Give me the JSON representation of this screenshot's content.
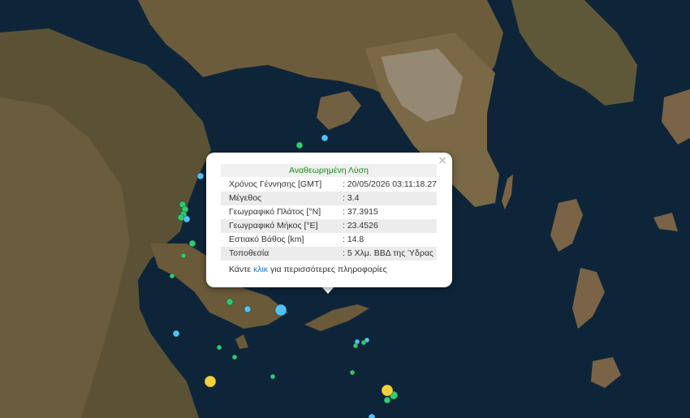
{
  "map": {
    "basemap": "satellite",
    "colors": {
      "sea": "#0d2438",
      "land": "#6b5a3c",
      "vegetation": "#4a4f2e",
      "urban": "#8e8370"
    },
    "events": [
      {
        "id": "e1",
        "color": "#2ecc71"
      },
      {
        "id": "e2",
        "color": "#2ecc71"
      },
      {
        "id": "e3",
        "color": "#2ecc71"
      },
      {
        "id": "e4",
        "color": "#2ecc71"
      },
      {
        "id": "e5",
        "color": "#2ecc71"
      },
      {
        "id": "e6",
        "color": "#2ecc71"
      },
      {
        "id": "e7",
        "color": "#2ecc71"
      },
      {
        "id": "e8",
        "color": "#2ecc71"
      },
      {
        "id": "e9",
        "color": "#2ecc71"
      },
      {
        "id": "e10",
        "color": "#2ecc71"
      },
      {
        "id": "e11",
        "color": "#2ecc71"
      },
      {
        "id": "e12",
        "color": "#2ecc71"
      },
      {
        "id": "e13",
        "color": "#2ecc71"
      },
      {
        "id": "e14",
        "color": "#2ecc71"
      },
      {
        "id": "e15",
        "color": "#2ecc71"
      },
      {
        "id": "e16",
        "color": "#2ecc71"
      },
      {
        "id": "e17",
        "color": "#2ecc71"
      },
      {
        "id": "e18",
        "color": "#4fc3f7"
      },
      {
        "id": "e19",
        "color": "#4fc3f7"
      },
      {
        "id": "e20",
        "color": "#4fc3f7"
      },
      {
        "id": "e21",
        "color": "#4fc3f7"
      },
      {
        "id": "e22",
        "color": "#4fc3f7"
      },
      {
        "id": "e23",
        "color": "#4fc3f7"
      },
      {
        "id": "e24",
        "color": "#4fc3f7"
      },
      {
        "id": "e25",
        "color": "#4fc3f7"
      },
      {
        "id": "e26",
        "color": "#4fc3f7"
      },
      {
        "id": "e27",
        "color": "#f1d23a"
      },
      {
        "id": "e28",
        "color": "#f1d23a"
      }
    ]
  },
  "popup": {
    "close_icon": "×",
    "title": "Αναθεωρημένη Λύση",
    "title_color": "#1e8a1e",
    "rows": [
      {
        "label": "Χρόνος Γέννησης [GMT]",
        "value": ": 20/05/2026 03:11:18.27"
      },
      {
        "label": "Μέγεθος",
        "value": ": 3.4"
      },
      {
        "label": "Γεωγραφικό Πλάτος [°N]",
        "value": ": 37.3915"
      },
      {
        "label": "Γεωγραφικό Μήκος [°E]",
        "value": ": 23.4526"
      },
      {
        "label": "Εστιακό Βάθος [km]",
        "value": ": 14.8"
      },
      {
        "label": "Τοποθεσία",
        "value": ": 5 Χλμ. ΒΒΔ της Ύδρας"
      }
    ],
    "more_prefix": "Κάντε ",
    "more_link": "κλικ",
    "more_suffix": " για περισσότερες πληροφορίες",
    "link_color": "#1a6fc9"
  }
}
